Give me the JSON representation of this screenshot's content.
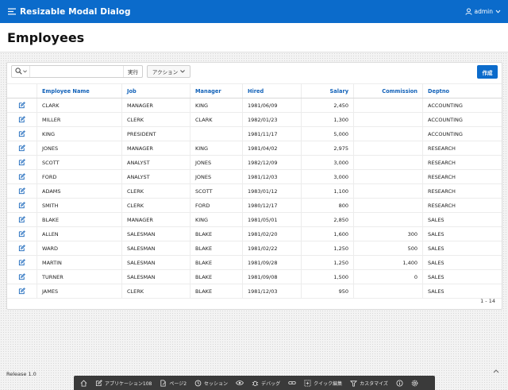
{
  "app": {
    "title": "Resizable Modal Dialog",
    "user": "admin"
  },
  "page": {
    "title": "Employees"
  },
  "toolbar": {
    "search_placeholder": "",
    "go_label": "実行",
    "actions_label": "アクション",
    "create_label": "作成"
  },
  "columns": [
    "",
    "Employee Name",
    "Job",
    "Manager",
    "Hired",
    "Salary",
    "Commission",
    "Deptno"
  ],
  "rows": [
    [
      "CLARK",
      "MANAGER",
      "KING",
      "1981/06/09",
      "2,450",
      "",
      "ACCOUNTING"
    ],
    [
      "MILLER",
      "CLERK",
      "CLARK",
      "1982/01/23",
      "1,300",
      "",
      "ACCOUNTING"
    ],
    [
      "KING",
      "PRESIDENT",
      "",
      "1981/11/17",
      "5,000",
      "",
      "ACCOUNTING"
    ],
    [
      "JONES",
      "MANAGER",
      "KING",
      "1981/04/02",
      "2,975",
      "",
      "RESEARCH"
    ],
    [
      "SCOTT",
      "ANALYST",
      "JONES",
      "1982/12/09",
      "3,000",
      "",
      "RESEARCH"
    ],
    [
      "FORD",
      "ANALYST",
      "JONES",
      "1981/12/03",
      "3,000",
      "",
      "RESEARCH"
    ],
    [
      "ADAMS",
      "CLERK",
      "SCOTT",
      "1983/01/12",
      "1,100",
      "",
      "RESEARCH"
    ],
    [
      "SMITH",
      "CLERK",
      "FORD",
      "1980/12/17",
      "800",
      "",
      "RESEARCH"
    ],
    [
      "BLAKE",
      "MANAGER",
      "KING",
      "1981/05/01",
      "2,850",
      "",
      "SALES"
    ],
    [
      "ALLEN",
      "SALESMAN",
      "BLAKE",
      "1981/02/20",
      "1,600",
      "300",
      "SALES"
    ],
    [
      "WARD",
      "SALESMAN",
      "BLAKE",
      "1981/02/22",
      "1,250",
      "500",
      "SALES"
    ],
    [
      "MARTIN",
      "SALESMAN",
      "BLAKE",
      "1981/09/28",
      "1,250",
      "1,400",
      "SALES"
    ],
    [
      "TURNER",
      "SALESMAN",
      "BLAKE",
      "1981/09/08",
      "1,500",
      "0",
      "SALES"
    ],
    [
      "JAMES",
      "CLERK",
      "BLAKE",
      "1981/12/03",
      "950",
      "",
      "SALES"
    ]
  ],
  "pagination": "1 - 14",
  "footer": {
    "release": "Release 1.0"
  },
  "devbar": [
    {
      "icon": "home-icon",
      "label": ""
    },
    {
      "icon": "edit-app-icon",
      "label": "アプリケーション108"
    },
    {
      "icon": "page-icon",
      "label": "ページ2"
    },
    {
      "icon": "session-icon",
      "label": "セッション"
    },
    {
      "icon": "eye-icon",
      "label": ""
    },
    {
      "icon": "debug-icon",
      "label": "デバッグ"
    },
    {
      "icon": "link-icon",
      "label": ""
    },
    {
      "icon": "quick-edit-icon",
      "label": "クイック編集"
    },
    {
      "icon": "customize-icon",
      "label": "カスタマイズ"
    },
    {
      "icon": "info-icon",
      "label": ""
    },
    {
      "icon": "settings-icon",
      "label": ""
    }
  ],
  "colors": {
    "brand": "#0b6bcb",
    "link": "#1262b9",
    "devbar": "#3a3a3a"
  }
}
